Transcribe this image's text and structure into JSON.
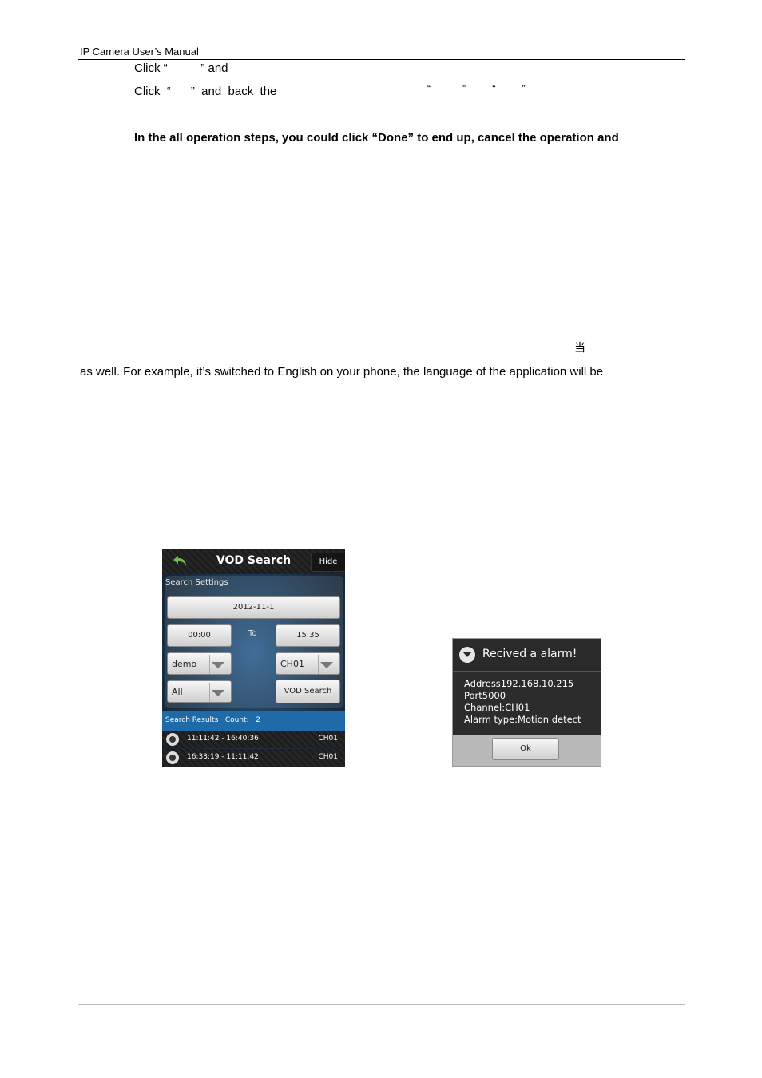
{
  "header": {
    "title": "IP Camera User’s Manual"
  },
  "text": {
    "line1": "Click “          ” and",
    "line2": "Click  “      ”  and  back  the",
    "line2_quotes": "“            ”          “          ”",
    "bold_note": "In the all operation steps, you could click “Done” to end up, cancel the operation and",
    "cjk_char": "当",
    "paragraph": "as well. For example, it’s switched to English on your phone, the language of the application will be"
  },
  "vod": {
    "title": "VOD Search",
    "hide_label": "Hide",
    "back_icon": "back-arrow-icon",
    "settings_label": "Search Settings",
    "date": "2012-11-1",
    "start_time": "00:00",
    "to_label": "To",
    "end_time": "15:35",
    "device": "demo",
    "channel": "CH01",
    "type": "All",
    "search_button": "VOD Search",
    "results_label": "Search Results   Count:   2",
    "results": [
      {
        "time": "11:11:42 - 16:40:36",
        "channel": "CH01"
      },
      {
        "time": "16:33:19 - 11:11:42",
        "channel": "CH01"
      }
    ],
    "colors": {
      "results_bar": "#1f6aa8",
      "accent_back": "#6cc04a"
    }
  },
  "alarm": {
    "title": "Recived a alarm!",
    "address": "Address192.168.10.215",
    "port": "Port5000",
    "channel": "Channel:CH01",
    "alarm_type": "Alarm type:Motion detect",
    "ok_label": "Ok"
  }
}
